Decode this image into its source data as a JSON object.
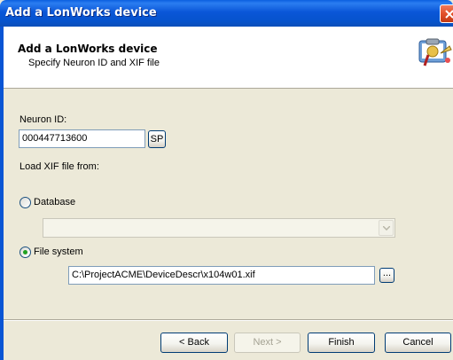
{
  "window": {
    "title": "Add a LonWorks device",
    "close_icon": "close-icon"
  },
  "header": {
    "title": "Add a LonWorks device",
    "subtitle": "Specify Neuron ID and XIF file",
    "icon": "wizard-icon"
  },
  "form": {
    "neuron_id_label": "Neuron ID:",
    "neuron_id_value": "000447713600",
    "sp_button_label": "SP",
    "load_xif_label": "Load XIF file from:",
    "database_option": {
      "label": "Database",
      "selected": false
    },
    "database_combo_value": "",
    "file_system_option": {
      "label": "File system",
      "selected": true
    },
    "file_path_value": "C:\\ProjectACME\\DeviceDescr\\x104w01.xif",
    "browse_button_label": "..."
  },
  "buttons": {
    "back": "< Back",
    "next": "Next >",
    "finish": "Finish",
    "cancel": "Cancel"
  },
  "colors": {
    "titlebar": "#0a56d8",
    "dialog_bg": "#ece9d8",
    "radio_selected": "#21a121"
  }
}
